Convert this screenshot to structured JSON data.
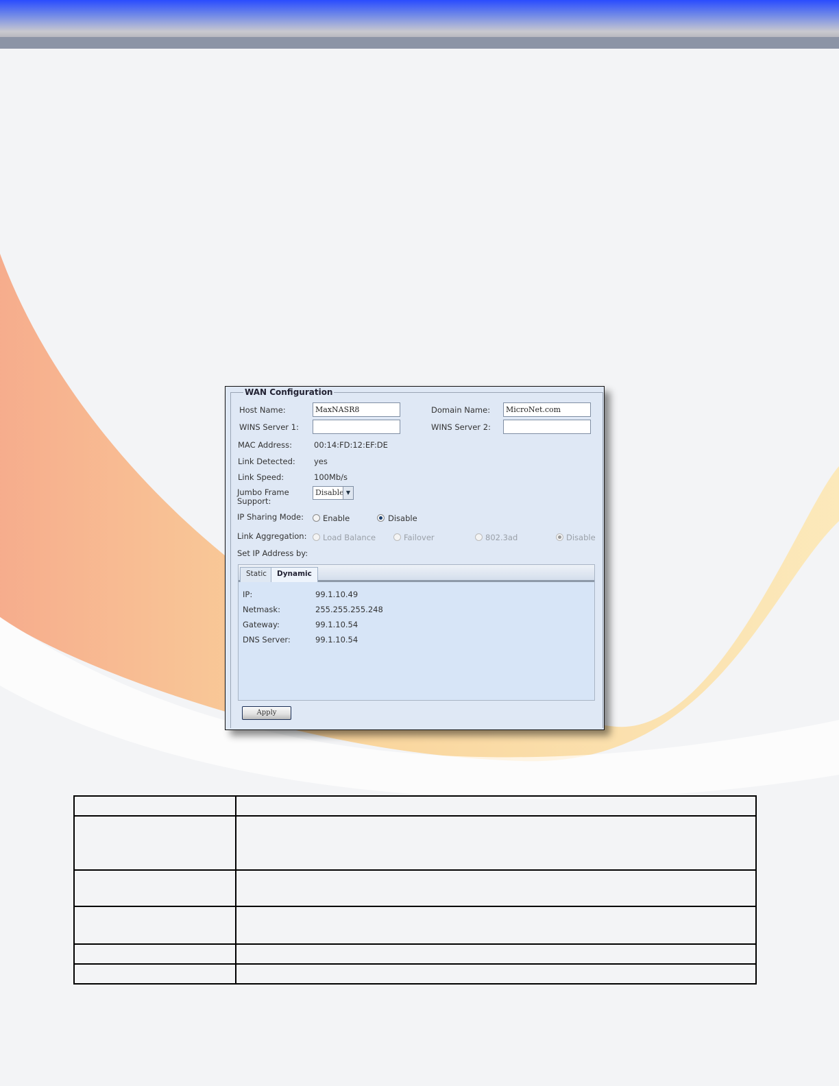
{
  "panel": {
    "title": "WAN Configuration",
    "host_name_label": "Host Name:",
    "host_name_value": "MaxNASR8",
    "domain_name_label": "Domain Name:",
    "domain_name_value": "MicroNet.com",
    "wins1_label": "WINS Server 1:",
    "wins1_value": "",
    "wins2_label": "WINS Server 2:",
    "wins2_value": "",
    "mac_label": "MAC Address:",
    "mac_value": "00:14:FD:12:EF:DE",
    "link_detected_label": "Link Detected:",
    "link_detected_value": "yes",
    "link_speed_label": "Link Speed:",
    "link_speed_value": "100Mb/s",
    "jumbo_label_1": "Jumbo Frame",
    "jumbo_label_2": "Support:",
    "jumbo_value": "Disable",
    "ip_sharing_label": "IP Sharing Mode:",
    "ip_sharing_options": [
      "Enable",
      "Disable"
    ],
    "ip_sharing_selected": "Disable",
    "link_agg_label": "Link Aggregation:",
    "link_agg_options": [
      "Load Balance",
      "Failover",
      "802.3ad",
      "Disable"
    ],
    "link_agg_selected": "Disable",
    "set_ip_label": "Set IP Address by:",
    "tabs": [
      "Static",
      "Dynamic"
    ],
    "active_tab": "Dynamic",
    "dynamic": [
      {
        "label": "IP:",
        "value": "99.1.10.49"
      },
      {
        "label": "Netmask:",
        "value": "255.255.255.248"
      },
      {
        "label": "Gateway:",
        "value": "99.1.10.54"
      },
      {
        "label": "DNS Server:",
        "value": "99.1.10.54"
      }
    ],
    "apply_label": "Apply"
  },
  "table": {
    "rows": [
      [
        "",
        ""
      ],
      [
        "",
        ""
      ],
      [
        "",
        ""
      ],
      [
        "",
        ""
      ],
      [
        "",
        ""
      ],
      [
        "",
        ""
      ]
    ]
  },
  "colors": {
    "header_blue": "#2a4cff",
    "panel_bg": "#dfe8f5",
    "swoosh": "#f8b070"
  }
}
